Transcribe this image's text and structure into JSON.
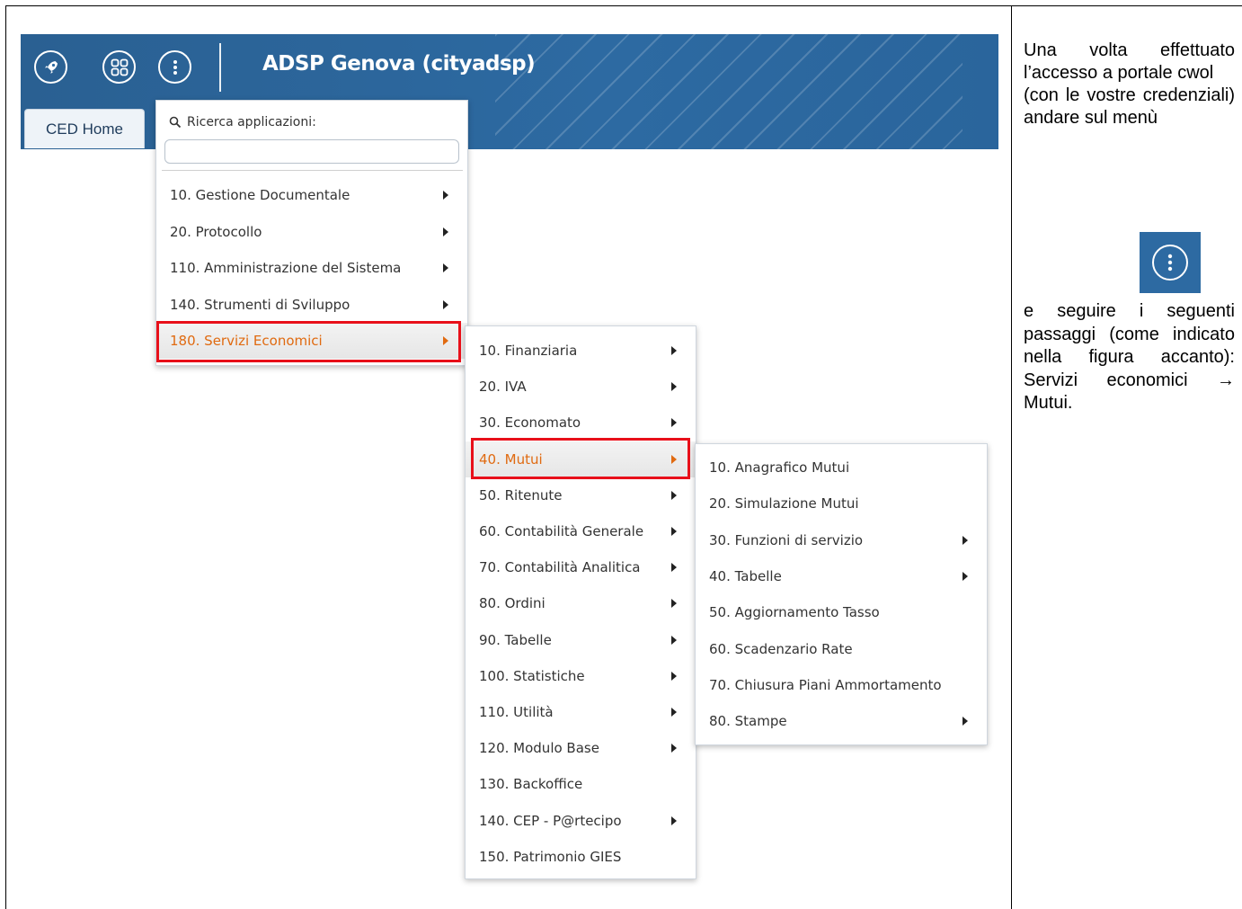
{
  "header": {
    "title": "ADSP Genova (cityadsp)",
    "tab_label": "CED Home"
  },
  "search": {
    "label": "Ricerca applicazioni:",
    "placeholder": "",
    "value": ""
  },
  "menu1": {
    "items": [
      {
        "label": "10. Gestione Documentale",
        "submenu": true
      },
      {
        "label": "20. Protocollo",
        "submenu": true
      },
      {
        "label": "110. Amministrazione del Sistema",
        "submenu": true
      },
      {
        "label": "140. Strumenti di Sviluppo",
        "submenu": true
      },
      {
        "label": "180. Servizi Economici",
        "submenu": true,
        "selected": true
      }
    ]
  },
  "menu2": {
    "items": [
      {
        "label": "10. Finanziaria",
        "submenu": true
      },
      {
        "label": "20. IVA",
        "submenu": true
      },
      {
        "label": "30. Economato",
        "submenu": true
      },
      {
        "label": "40. Mutui",
        "submenu": true,
        "selected": true
      },
      {
        "label": "50. Ritenute",
        "submenu": true
      },
      {
        "label": "60. Contabilità Generale",
        "submenu": true
      },
      {
        "label": "70. Contabilità Analitica",
        "submenu": true
      },
      {
        "label": "80. Ordini",
        "submenu": true
      },
      {
        "label": "90. Tabelle",
        "submenu": true
      },
      {
        "label": "100. Statistiche",
        "submenu": true
      },
      {
        "label": "110. Utilità",
        "submenu": true
      },
      {
        "label": "120. Modulo Base",
        "submenu": true
      },
      {
        "label": "130. Backoffice",
        "submenu": false
      },
      {
        "label": "140. CEP - P@rtecipo",
        "submenu": true
      },
      {
        "label": "150. Patrimonio GIES",
        "submenu": false
      }
    ]
  },
  "menu3": {
    "items": [
      {
        "label": "10. Anagrafico Mutui",
        "submenu": false
      },
      {
        "label": "20. Simulazione Mutui",
        "submenu": false
      },
      {
        "label": "30. Funzioni di servizio",
        "submenu": true
      },
      {
        "label": "40. Tabelle",
        "submenu": true
      },
      {
        "label": "50. Aggiornamento Tasso",
        "submenu": false
      },
      {
        "label": "60. Scadenzario Rate",
        "submenu": false
      },
      {
        "label": "70. Chiusura Piani Ammortamento",
        "submenu": false
      },
      {
        "label": "80. Stampe",
        "submenu": true
      }
    ]
  },
  "instructions": {
    "part1": "Una volta effettuato l’accesso a portale cwol",
    "part2": "(con le vostre credenziali) andare sul menù",
    "part3": "e seguire i seguenti passaggi (come indicato nella figura accanto):",
    "path": "Servizi economici → Mutui."
  },
  "icons": {
    "rocket": "rocket-icon",
    "apps": "apps-grid-icon",
    "kebab": "kebab-menu-icon",
    "search": "search-icon"
  },
  "colors": {
    "header_blue": "#2d6aa2",
    "highlight_orange": "#e06a10",
    "red_outline": "#e8101a"
  }
}
